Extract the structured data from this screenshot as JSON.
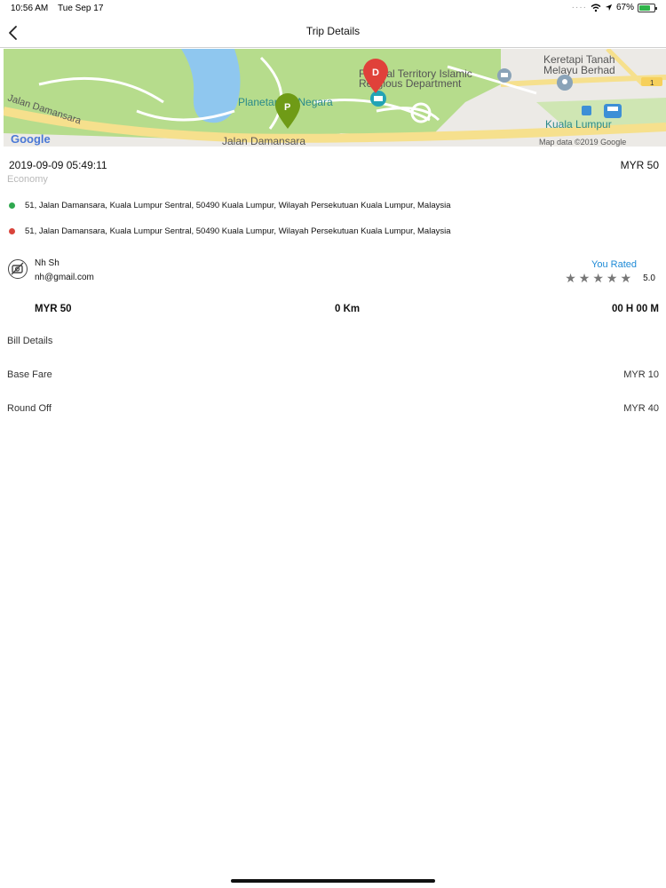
{
  "status": {
    "time": "10:56 AM",
    "date": "Tue Sep 17",
    "battery": "67%"
  },
  "nav": {
    "title": "Trip Details"
  },
  "map": {
    "labels": {
      "territory": "Federal Territory Islamic",
      "department": "Religious Department",
      "keretapi": "Keretapi Tanah",
      "melayu": "Melayu Berhad",
      "planetarium": "Planetarium Negara",
      "jalan1": "Jalan Damansara",
      "jalan2": "Jalan Damansara",
      "kuala": "Kuala Lumpur",
      "google": "Google",
      "attribution": "Map data ©2019 Google",
      "road_number": "1"
    },
    "pins": {
      "pickup": "P",
      "drop": "D"
    },
    "colors": {
      "park": "#b6dc8c",
      "water": "#8fc7ef",
      "road": "#f6e08d",
      "land": "#eceae6",
      "pickup_pin": "#6f9b16",
      "drop_pin": "#e0413a"
    }
  },
  "trip": {
    "datetime": "2019-09-09 05:49:11",
    "fare": "MYR 50",
    "class": "Economy",
    "pickup_address": "51, Jalan Damansara, Kuala Lumpur Sentral, 50490 Kuala Lumpur, Wilayah Persekutuan Kuala Lumpur, Malaysia",
    "drop_address": "51, Jalan Damansara, Kuala Lumpur Sentral, 50490 Kuala Lumpur, Wilayah Persekutuan Kuala Lumpur, Malaysia",
    "pickup_color": "#2fa84f",
    "drop_color": "#d9443b"
  },
  "driver": {
    "name": "Nh Sh",
    "email": "nh@gmail.com",
    "rated_label": "You Rated",
    "stars": "★★★★★",
    "rating": "5.0",
    "rating_stars_filled": 5
  },
  "summary": {
    "fare": "MYR 50",
    "distance": "0 Km",
    "time": "00 H 00 M"
  },
  "bill": {
    "title": "Bill Details",
    "rows": [
      {
        "label": "Base Fare",
        "value": "MYR 10"
      },
      {
        "label": "Round Off",
        "value": "MYR 40"
      }
    ]
  }
}
